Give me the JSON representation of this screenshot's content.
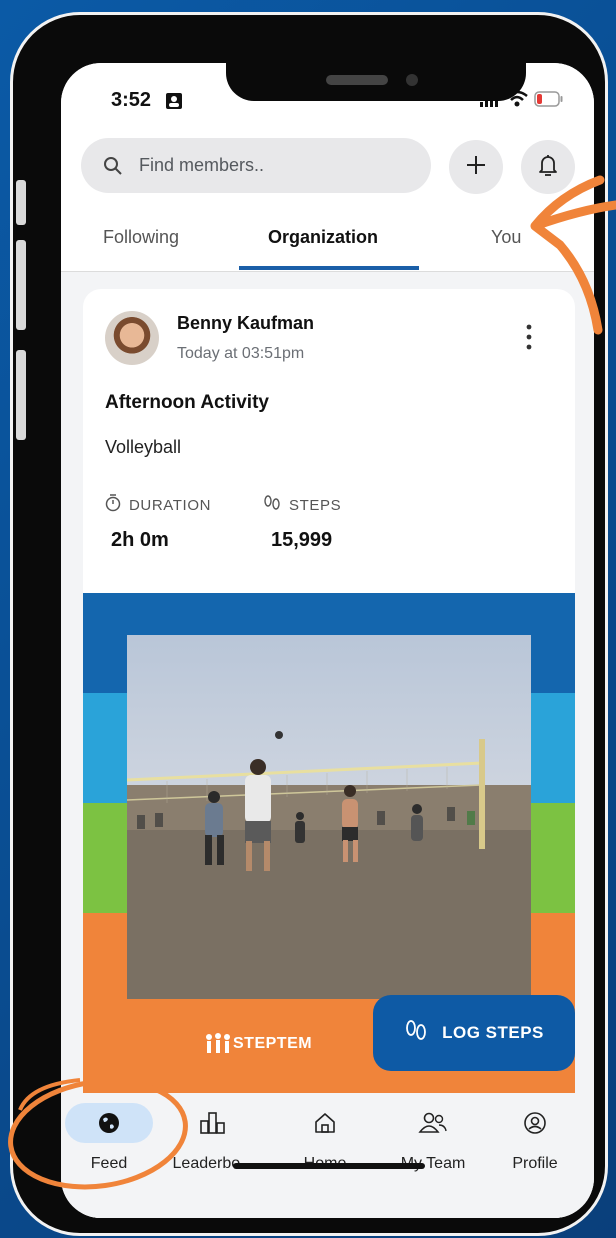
{
  "status": {
    "time": "3:52"
  },
  "search": {
    "placeholder": "Find members.."
  },
  "tabs": [
    {
      "label": "Following"
    },
    {
      "label": "Organization"
    },
    {
      "label": "You"
    }
  ],
  "post": {
    "user_name": "Benny Kaufman",
    "timestamp": "Today at 03:51pm",
    "activity_title": "Afternoon Activity",
    "activity_type": "Volleyball",
    "stats": [
      {
        "label": "DURATION",
        "value": "2h 0m",
        "icon": "timer-icon"
      },
      {
        "label": "STEPS",
        "value": "15,999",
        "icon": "footprints-icon"
      }
    ],
    "brand_text": "STEPTEM"
  },
  "fab": {
    "label": "LOG STEPS",
    "icon": "footprints-icon"
  },
  "nav": [
    {
      "label": "Feed",
      "icon": "globe-icon",
      "active": true
    },
    {
      "label": "Leaderbo...",
      "icon": "bar-chart-icon"
    },
    {
      "label": "Home",
      "icon": "home-icon"
    },
    {
      "label": "My Team",
      "icon": "team-icon"
    },
    {
      "label": "Profile",
      "icon": "profile-icon"
    }
  ],
  "colors": {
    "accent": "#1a5fa8",
    "fab": "#0e5aa5",
    "annotation": "#f0843a",
    "battery_low": "#e53935"
  }
}
